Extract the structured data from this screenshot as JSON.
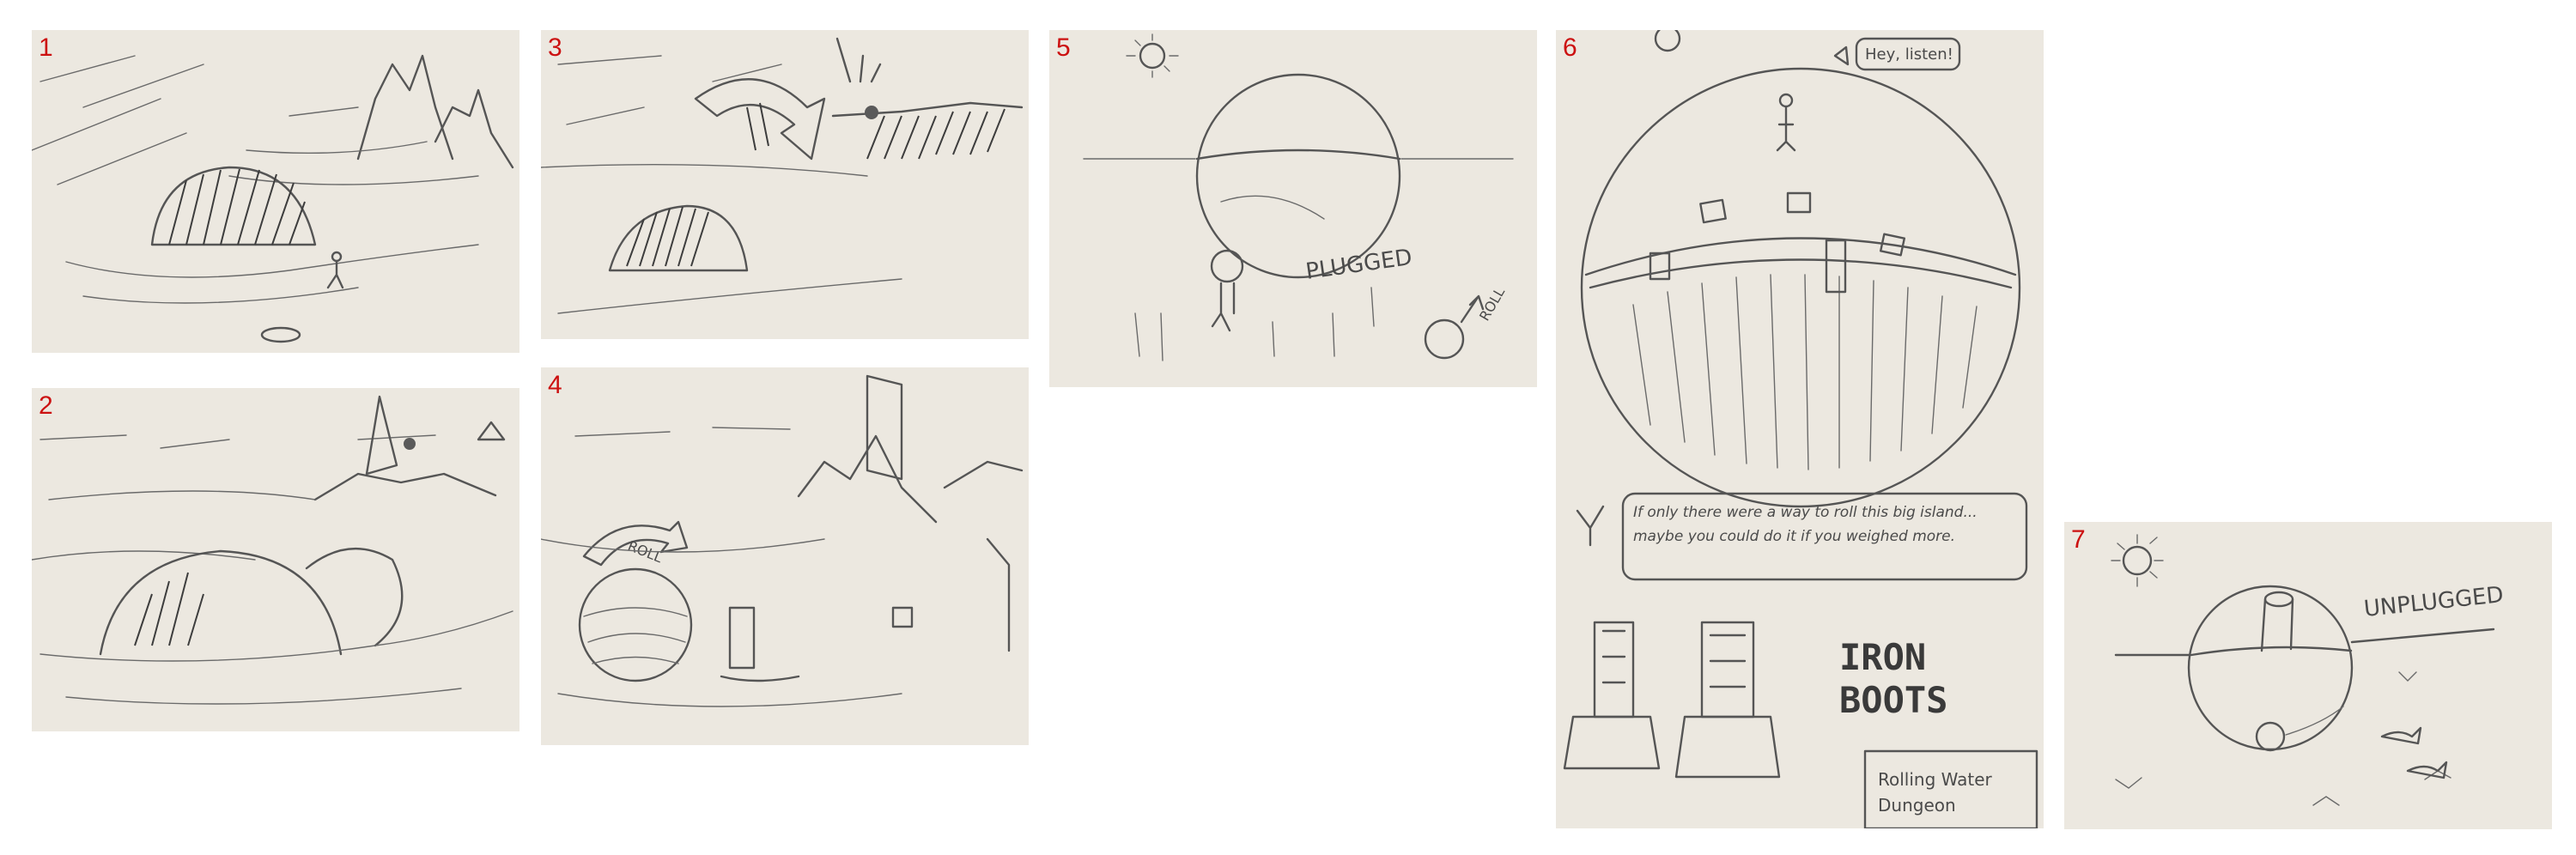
{
  "panels": [
    {
      "number": "1"
    },
    {
      "number": "2"
    },
    {
      "number": "3"
    },
    {
      "number": "4",
      "ball_label": "ROLL"
    },
    {
      "number": "5",
      "plugged_label": "PLUGGED",
      "roll_label": "ROLL"
    },
    {
      "number": "6",
      "speech_top": "Hey, listen!",
      "hint_text": "If only there were a way to roll this big island... maybe you could do it if you weighed more.",
      "item_title_line1": "IRON",
      "item_title_line2": "BOOTS",
      "sign_line1": "Rolling Water",
      "sign_line2": "Dungeon"
    },
    {
      "number": "7",
      "unplugged_label": "UNPLUGGED"
    }
  ],
  "colors": {
    "paper": "#ece8e0",
    "panel_number": "#cc1111",
    "pencil": "#555555"
  }
}
